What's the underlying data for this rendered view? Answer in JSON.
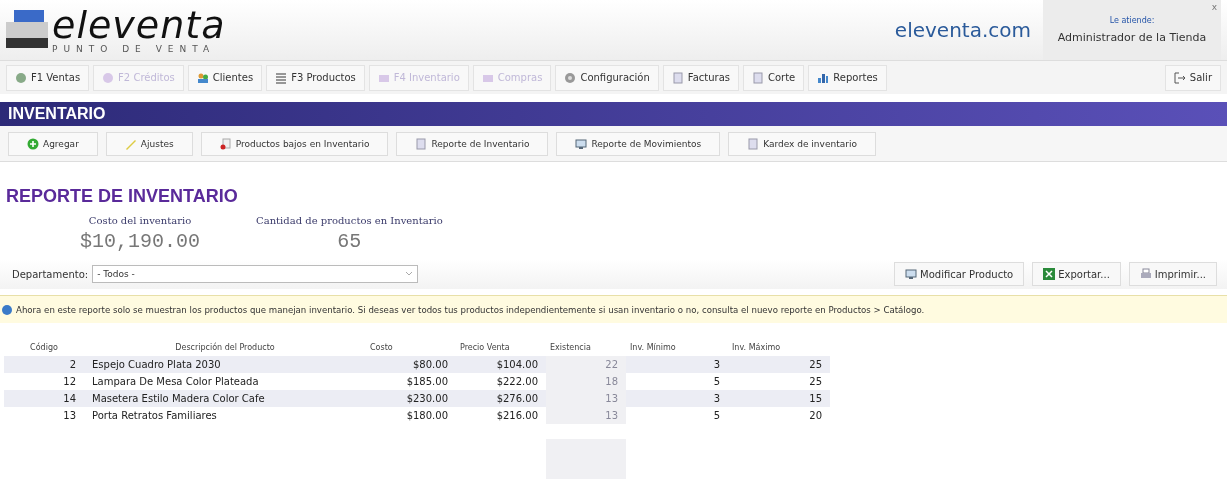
{
  "header": {
    "logo_name": "eleventa",
    "logo_tagline": "PUNTO DE VENTA",
    "site": "eleventa.com",
    "user_caption": "Le atiende:",
    "user_name": "Administrador de la Tienda",
    "close": "x"
  },
  "nav": [
    {
      "label": "F1 Ventas",
      "disabled": false,
      "kind": "circle"
    },
    {
      "label": "F2 Créditos",
      "disabled": true,
      "kind": "circle"
    },
    {
      "label": "Clientes",
      "disabled": false,
      "kind": "people"
    },
    {
      "label": "F3 Productos",
      "disabled": false,
      "kind": "list"
    },
    {
      "label": "F4 Inventario",
      "disabled": true,
      "kind": "box"
    },
    {
      "label": "Compras",
      "disabled": true,
      "kind": "box"
    },
    {
      "label": "Configuración",
      "disabled": false,
      "kind": "gear"
    },
    {
      "label": "Facturas",
      "disabled": false,
      "kind": "doc"
    },
    {
      "label": "Corte",
      "disabled": false,
      "kind": "doc"
    },
    {
      "label": "Reportes",
      "disabled": false,
      "kind": "chart"
    }
  ],
  "logout": "Salir",
  "section_title": "INVENTARIO",
  "toolbar": [
    {
      "label": "Agregar",
      "kind": "plus"
    },
    {
      "label": "Ajustes",
      "kind": "pencil"
    },
    {
      "label": "Productos bajos en Inventario",
      "kind": "alert"
    },
    {
      "label": "Reporte de Inventario",
      "kind": "doc"
    },
    {
      "label": "Reporte de Movimientos",
      "kind": "screen"
    },
    {
      "label": "Kardex de inventario",
      "kind": "doc"
    }
  ],
  "report_title": "REPORTE DE INVENTARIO",
  "summary": [
    {
      "label": "Costo del inventario",
      "value": "$10,190.00"
    },
    {
      "label": "Cantidad de productos en Inventario",
      "value": "65"
    }
  ],
  "department": {
    "label": "Departamento:",
    "value": "- Todos -"
  },
  "actions": [
    {
      "label": "Modificar Producto",
      "kind": "screen"
    },
    {
      "label": "Exportar...",
      "kind": "excel"
    },
    {
      "label": "Imprimir...",
      "kind": "printer"
    }
  ],
  "info": "Ahora en este reporte solo se muestran los productos que manejan inventario. Si deseas ver todos tus productos independientemente si usan inventario o no, consulta el nuevo reporte en Productos > Catálogo.",
  "table": {
    "columns": [
      "Código",
      "Descripción del Producto",
      "Costo",
      "Precio Venta",
      "Existencia",
      "Inv. Mínimo",
      "Inv. Máximo"
    ],
    "rows": [
      [
        "2",
        "Espejo Cuadro Plata  2030",
        "$80.00",
        "$104.00",
        "22",
        "3",
        "25"
      ],
      [
        "12",
        "Lampara De Mesa Color Plateada",
        "$185.00",
        "$222.00",
        "18",
        "5",
        "25"
      ],
      [
        "14",
        "Masetera Estilo Madera Color Cafe",
        "$230.00",
        "$276.00",
        "13",
        "3",
        "15"
      ],
      [
        "13",
        "Porta Retratos Familiares",
        "$180.00",
        "$216.00",
        "13",
        "5",
        "20"
      ]
    ]
  }
}
